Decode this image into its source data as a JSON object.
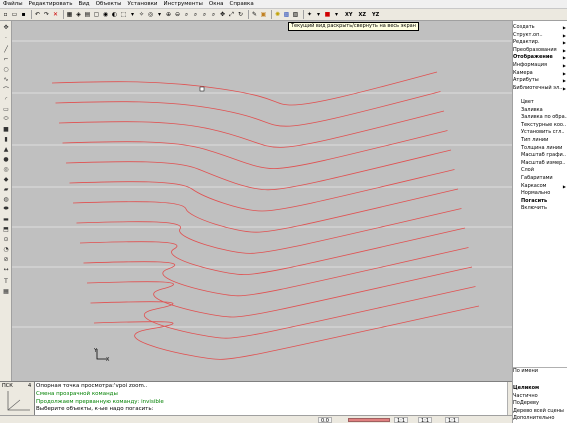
{
  "menu": {
    "items": [
      "Файлы",
      "Редактировать",
      "Вид",
      "Объекты",
      "Установки",
      "Инструменты",
      "Окна",
      "Справка"
    ]
  },
  "toolbar": {
    "tooltip": "Текущий вид раскрыть/свернуть на весь экран",
    "xy_label": "XY",
    "xz_label": "XZ",
    "yz_label": "YZ"
  },
  "ucs": {
    "label": "ПСК",
    "number": "4",
    "y_axis_label": "Y",
    "x_axis_label": "X"
  },
  "command_lines": [
    {
      "text": "Опорная точка просмотра:'vpoi zoom..",
      "color": "black"
    },
    {
      "text": "Смена прозрачной команды",
      "color": "green"
    },
    {
      "text": "Продолжаем прерванную команду: invisible",
      "color": "green"
    },
    {
      "text": "Выберите объекты, к-ые надо погасить:",
      "color": "black"
    }
  ],
  "status": {
    "coord": "0.0",
    "scale1": "1:1",
    "scale2": "1:1",
    "scale3": "1:1"
  },
  "right_panel": {
    "menu1": [
      {
        "label": "Создать",
        "bold": false,
        "arrow": true
      },
      {
        "label": "Структ.оп..",
        "bold": false,
        "arrow": true
      },
      {
        "label": "Редактир.",
        "bold": false,
        "arrow": true
      },
      {
        "label": "Преобразования",
        "bold": false,
        "arrow": true
      },
      {
        "label": "Отображение",
        "bold": true,
        "arrow": true
      },
      {
        "label": "Информация",
        "bold": false,
        "arrow": true
      },
      {
        "label": "Камера",
        "bold": false,
        "arrow": true
      },
      {
        "label": "Атрибуты",
        "bold": false,
        "arrow": true
      },
      {
        "label": "Библиотечный эл..",
        "bold": false,
        "arrow": true
      }
    ],
    "menu2": [
      {
        "label": "Цвет",
        "bold": false
      },
      {
        "label": "Заливка",
        "bold": false
      },
      {
        "label": "Заливка по обра..",
        "bold": false
      },
      {
        "label": "Текстурные коо..",
        "bold": false
      },
      {
        "label": "Установить сгл..",
        "bold": false
      },
      {
        "label": "Тип линии",
        "bold": false
      },
      {
        "label": "Толщина линии",
        "bold": false
      },
      {
        "label": "Масштаб графи..",
        "bold": false
      },
      {
        "label": "Масштаб измер..",
        "bold": false
      },
      {
        "label": "Слой",
        "bold": false
      },
      {
        "label": "Габаритами",
        "bold": false
      },
      {
        "label": "Каркасом",
        "bold": false,
        "arrow": true
      },
      {
        "label": "Нормально",
        "bold": false
      },
      {
        "label": "Погасить",
        "bold": true
      },
      {
        "label": "Включить",
        "bold": false
      }
    ],
    "menu3": [
      {
        "label": "По имени",
        "bold": false
      }
    ],
    "menu4": [
      {
        "label": "Целиком",
        "bold": true
      },
      {
        "label": "Частично",
        "bold": false
      },
      {
        "label": "ПоДереву",
        "bold": false
      },
      {
        "label": "Дерево всей сцены",
        "bold": false
      },
      {
        "label": "Дополнительно",
        "bold": false
      }
    ]
  },
  "colors": {
    "curve": "#e05050",
    "canvas": "#c0c0c0",
    "grid": "#e8e8e8"
  }
}
